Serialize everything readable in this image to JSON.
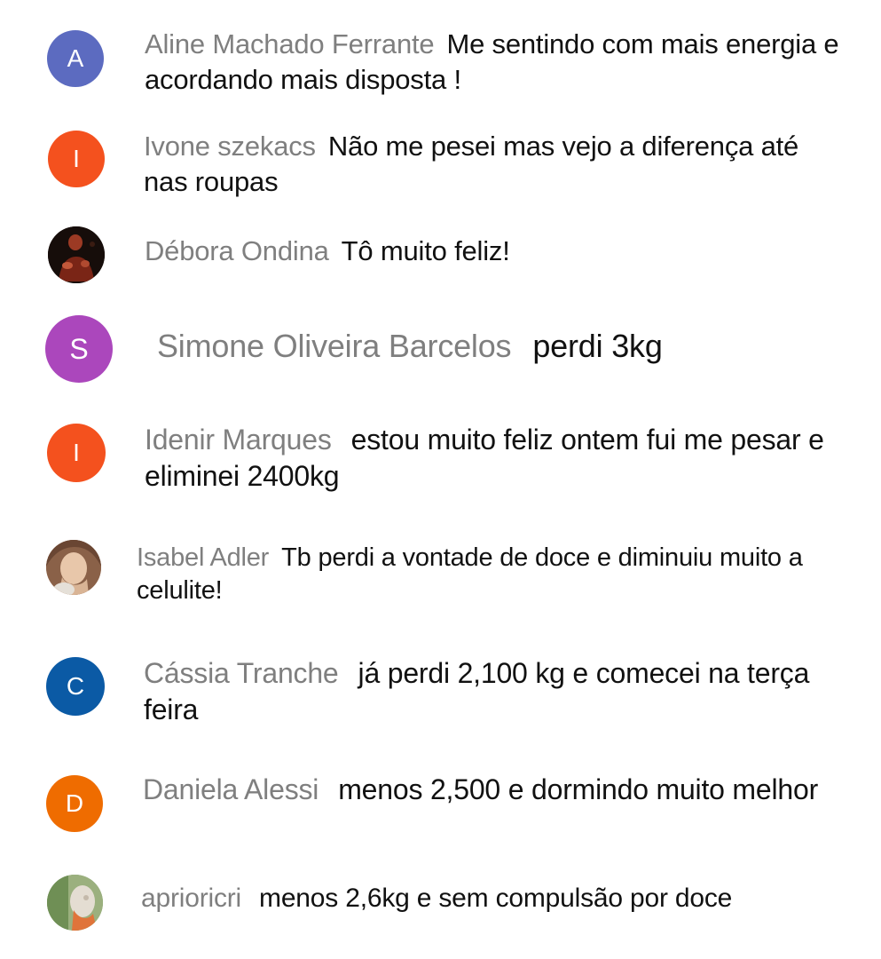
{
  "comments": [
    {
      "author": "Aline Machado Ferrante",
      "message": "Me sentindo com mais energia e acordando mais disposta !",
      "avatar_letter": "A",
      "avatar_color": "#5c6bc0"
    },
    {
      "author": "Ivone szekacs",
      "message": "Não me pesei mas vejo a diferença até nas roupas",
      "avatar_letter": "I",
      "avatar_color": "#f4511e"
    },
    {
      "author": "Débora Ondina",
      "message": "Tô muito feliz!",
      "avatar_photo": "dark-portrait"
    },
    {
      "author": "Simone Oliveira Barcelos",
      "message": "perdi 3kg",
      "avatar_letter": "S",
      "avatar_color": "#ab47bc"
    },
    {
      "author": "Idenir Marques",
      "message": "estou muito feliz ontem fui me pesar e eliminei 2400kg",
      "avatar_letter": "I",
      "avatar_color": "#f4511e"
    },
    {
      "author": "Isabel Adler",
      "message": "Tb perdi a vontade de doce e diminuiu muito a celulite!",
      "avatar_photo": "smiling-woman"
    },
    {
      "author": "Cássia Tranche",
      "message": "já perdi 2,100 kg e comecei na terça feira",
      "avatar_letter": "C",
      "avatar_color": "#0b5aa5"
    },
    {
      "author": "Daniela Alessi",
      "message": "menos 2,500 e dormindo muito melhor",
      "avatar_letter": "D",
      "avatar_color": "#ef6c00"
    },
    {
      "author": "aprioricri",
      "message": "menos 2,6kg e sem compulsão por doce",
      "avatar_photo": "green-photo"
    }
  ]
}
